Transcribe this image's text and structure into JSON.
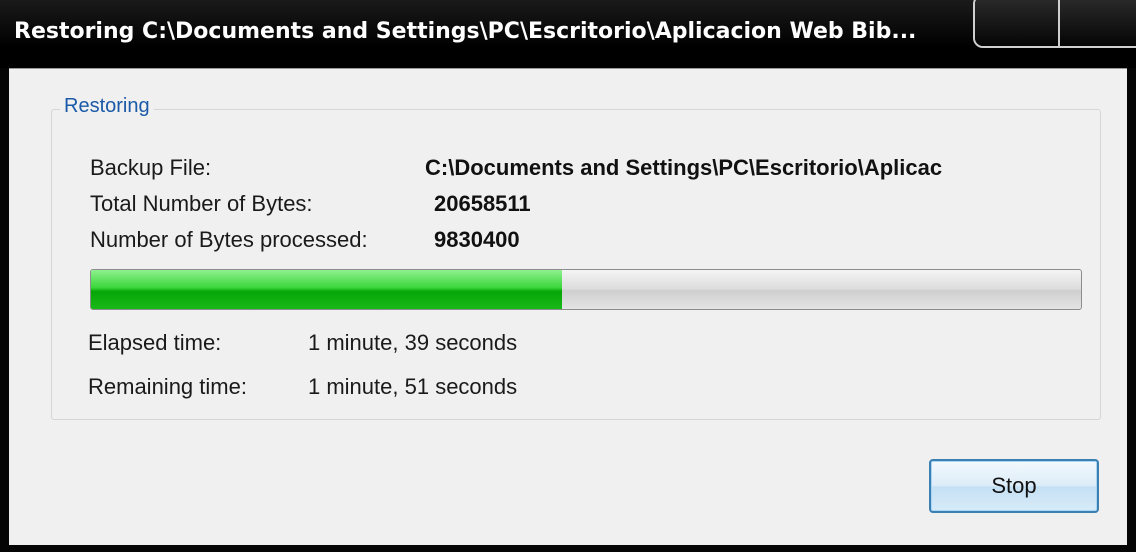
{
  "window": {
    "title": "Restoring C:\\Documents and Settings\\PC\\Escritorio\\Aplicacion Web Bib..."
  },
  "group": {
    "legend": "Restoring"
  },
  "info": {
    "backup_file_label": "Backup File:",
    "backup_file_value": "C:\\Documents and Settings\\PC\\Escritorio\\Aplicac",
    "total_bytes_label": "Total Number of Bytes:",
    "total_bytes_value": "20658511",
    "processed_bytes_label": "Number of Bytes processed:",
    "processed_bytes_value": "9830400"
  },
  "progress": {
    "fraction": 0.476
  },
  "timing": {
    "elapsed_label": "Elapsed time:",
    "elapsed_value": "1 minute, 39 seconds",
    "remaining_label": "Remaining time:",
    "remaining_value": "1 minute, 51 seconds"
  },
  "buttons": {
    "stop_label": "Stop"
  },
  "colors": {
    "progress_fill": "#19b919",
    "legend_text": "#1a5aa8",
    "button_border": "#3c7fb1"
  }
}
